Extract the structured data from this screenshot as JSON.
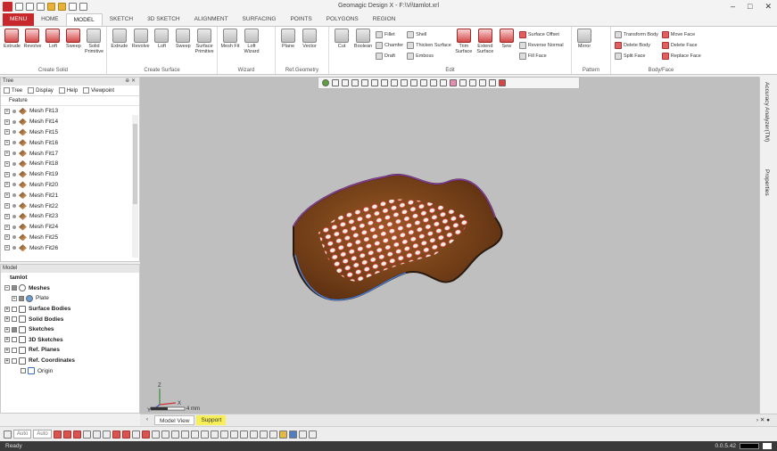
{
  "window": {
    "title": "Geomagic Design X - F:\\Vi\\tamlot.xrl",
    "controls": [
      "–",
      "□",
      "✕"
    ]
  },
  "tabs": [
    "MENU",
    "HOME",
    "MODEL",
    "SKETCH",
    "3D SKETCH",
    "ALIGNMENT",
    "SURFACING",
    "POINTS",
    "POLYGONS",
    "REGION"
  ],
  "ribbon": {
    "create_solid": {
      "label": "Create Solid",
      "buttons": [
        "Extrude",
        "Revolve",
        "Loft",
        "Sweep",
        "Solid Primitive"
      ]
    },
    "create_surface": {
      "label": "Create Surface",
      "buttons": [
        "Extrude",
        "Revolve",
        "Loft",
        "Sweep",
        "Surface Primitive"
      ]
    },
    "wizard": {
      "label": "Wizard",
      "buttons": [
        "Mesh Fit",
        "Loft Wizard"
      ]
    },
    "ref_geometry": {
      "label": "Ref.Geometry",
      "buttons": [
        "Plane",
        "Vector"
      ]
    },
    "edit": {
      "label": "Edit",
      "buttons": [
        "Cut",
        "Boolean"
      ],
      "small1": [
        "Fillet",
        "Chamfer",
        "Draft"
      ],
      "small2": [
        "Shell",
        "Thicken Surface",
        "Emboss"
      ],
      "big2": [
        "Trim Surface",
        "Extend Surface",
        "Sew"
      ],
      "small3": [
        "Surface Offset",
        "Reverse Normal",
        "Fill Face"
      ]
    },
    "pattern": {
      "label": "Pattern",
      "buttons": [
        "Mirror"
      ]
    },
    "body_face": {
      "label": "Body/Face",
      "small1": [
        "Transform Body",
        "Delete Body",
        "Split Face"
      ],
      "small2": [
        "Move Face",
        "Delete Face",
        "Replace Face"
      ]
    }
  },
  "tree_panel": {
    "title": "Tree",
    "tools": [
      "Tree",
      "Display",
      "Help",
      "Viewpoint"
    ],
    "header": "Feature",
    "items": [
      "Mesh Fit13",
      "Mesh Fit14",
      "Mesh Fit15",
      "Mesh Fit16",
      "Mesh Fit17",
      "Mesh Fit18",
      "Mesh Fit19",
      "Mesh Fit20",
      "Mesh Fit21",
      "Mesh Fit22",
      "Mesh Fit23",
      "Mesh Fit24",
      "Mesh Fit25",
      "Mesh Fit26"
    ]
  },
  "model_panel": {
    "title": "Model",
    "root": "tamlot",
    "items": [
      "Meshes",
      "Plate",
      "Surface Bodies",
      "Solid Bodies",
      "Sketches",
      "3D Sketches",
      "Ref. Planes",
      "Ref. Coordinates",
      "Origin"
    ]
  },
  "right_tabs": [
    "Accuracy Analyzer(TM)",
    "Properties"
  ],
  "viewport": {
    "scale_label": "4 mm",
    "axes": [
      "Z",
      "X",
      "Y"
    ]
  },
  "viewport_tabs": [
    "Model View",
    "Support"
  ],
  "bottom_toolbar": {
    "select1": "Auto",
    "select2": "Auto"
  },
  "status": {
    "text": "Ready",
    "right": "0.0.5.42"
  }
}
